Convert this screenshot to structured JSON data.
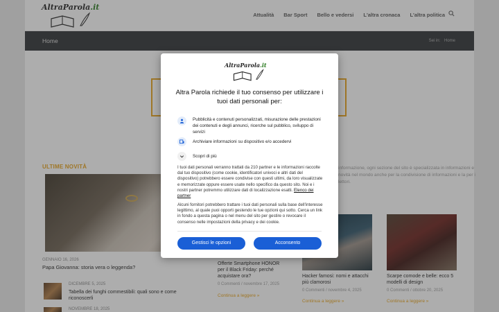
{
  "site": {
    "logo_text": "AltraParola",
    "logo_tld": ".it",
    "nav": [
      "Attualità",
      "Bar Sport",
      "Bello e vedersi",
      "L'altra cronaca",
      "L'altra politica"
    ]
  },
  "breadcrumb": {
    "title": "Home",
    "prefix": "Sei in:",
    "current": "Home"
  },
  "latest": {
    "section_title": "ULTIME NOVITÀ",
    "hero": {
      "date": "GENNAIO 16, 2026",
      "title": "Papa Giovanna: storia vera o leggenda?"
    },
    "items": [
      {
        "date": "DICEMBRE 5, 2025",
        "title": "Tabella dei funghi commestibili: quali sono e come riconoscerli"
      },
      {
        "date": "NOVEMBRE 18, 2025"
      }
    ]
  },
  "side_text": "informazione, ogni sezione del sito è specializzata in informazioni e novità nel mondo anche per la condivisione di informazioni e la per i lettori.",
  "cards": [
    {
      "title": "Offerte Smartphone HONOR per il Black Friday: perché acquistare ora?",
      "meta": "0 Commenti / novembre 17, 2025"
    },
    {
      "title": "Hacker famosi: nomi e attacchi più clamorosi",
      "meta": "0 Commenti / novembre 4, 2025",
      "more": "Continua a leggere »"
    },
    {
      "title": "Scarpe comode e belle: ecco 5 modelli di design",
      "meta": "0 Commenti / ottobre 20, 2025",
      "more": "Continua a leggere »"
    }
  ],
  "card0_more": "Continua a leggere »",
  "consent": {
    "heading": "Altra Parola richiede il tuo consenso per utilizzare i tuoi dati personali per:",
    "purposes": [
      {
        "icon": "person-icon",
        "text": "Pubblicità e contenuti personalizzati, misurazione delle prestazioni dei contenuti e degli annunci, ricerche sul pubblico, sviluppo di servizi"
      },
      {
        "icon": "device-icon",
        "text": "Archiviare informazioni su dispositivo e/o accedervi"
      }
    ],
    "learn_more": "Scopri di più",
    "body_1": "I tuoi dati personali verranno trattati da 210 partner e le informazioni raccolte dal tuo dispositivo (come cookie, identificatori univoci e altri dati del dispositivo) potrebbero essere condivise con questi ultimi, da loro visualizzate e memorizzate oppure essere usate nello specifico da questo sito. Noi e i nostri partner potremmo utilizzare dati di localizzazione esatti.",
    "partners_link": "Elenco dei partner",
    "body_2": "Alcuni fornitori potrebbero trattare i tuoi dati personali sulla base dell'interesse legittimo, al quale puoi opporti gestendo le tue opzioni qui sotto. Cerca un link in fondo a questa pagina o nel menu del sito per gestire o revocare il consenso nelle impostazioni della privacy e dei cookie.",
    "manage_button": "Gestisci le opzioni",
    "accept_button": "Acconsento"
  }
}
